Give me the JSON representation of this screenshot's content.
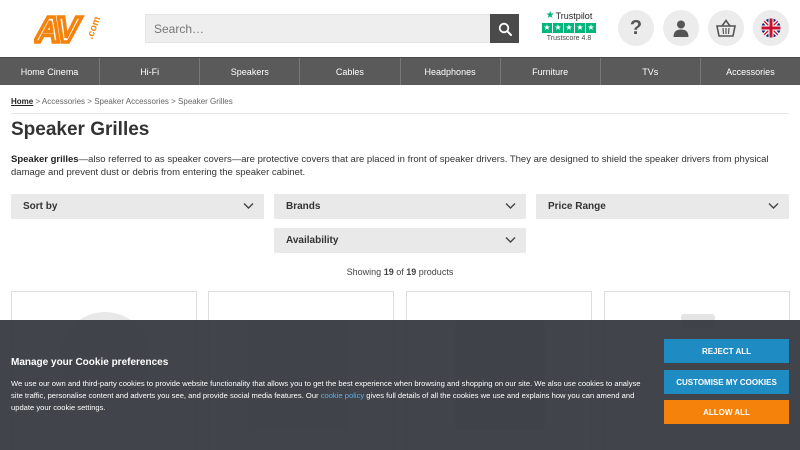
{
  "header": {
    "logo_text": "AV",
    "logo_sub": ".com",
    "search_placeholder": "Search…",
    "trustpilot": {
      "brand": "Trustpilot",
      "score_label": "Trustscore 4.8",
      "stars": 5
    }
  },
  "icons": {
    "search": "search-icon",
    "help": "question-icon",
    "account": "user-icon",
    "basket": "basket-icon",
    "language": "uk-flag-icon"
  },
  "nav": [
    "Home Cinema",
    "Hi-Fi",
    "Speakers",
    "Cables",
    "Headphones",
    "Furniture",
    "TVs",
    "Accessories"
  ],
  "breadcrumb": {
    "home": "Home",
    "items": [
      "Accessories",
      "Speaker Accessories",
      "Speaker Grilles"
    ],
    "separator": ">"
  },
  "page": {
    "title": "Speaker Grilles",
    "desc_bold": "Speaker grilles",
    "desc_rest": "—also referred to as speaker covers—are protective covers that are placed in front of speaker drivers. They are designed to shield the speaker drivers from physical damage and prevent dust or debris from entering the speaker cabinet."
  },
  "filters": {
    "sort": "Sort by",
    "brands": "Brands",
    "price": "Price Range",
    "availability": "Availability"
  },
  "results": {
    "prefix": "Showing",
    "shown": "19",
    "of": "of",
    "total": "19",
    "suffix": "products"
  },
  "cookie": {
    "title": "Manage your Cookie preferences",
    "text_before": "We use our own and third-party cookies to provide website functionality that allows you to get the best experience when browsing and shopping on our site. We also use cookies to analyse site traffic, personalise content and adverts you see, and provide social media features. Our ",
    "link": "cookie policy",
    "text_after": " gives full details of all the cookies we use and explains how you can amend and update your cookie settings.",
    "reject": "REJECT ALL",
    "customise": "CUSTOMISE MY COOKIES",
    "allow": "ALLOW ALL"
  },
  "colors": {
    "brand_orange": "#f5820a",
    "nav_bg": "#5a5a5a",
    "trustpilot_green": "#00b67a",
    "cookie_blue": "#1e8bc3",
    "cookie_orange": "#f5820a"
  }
}
